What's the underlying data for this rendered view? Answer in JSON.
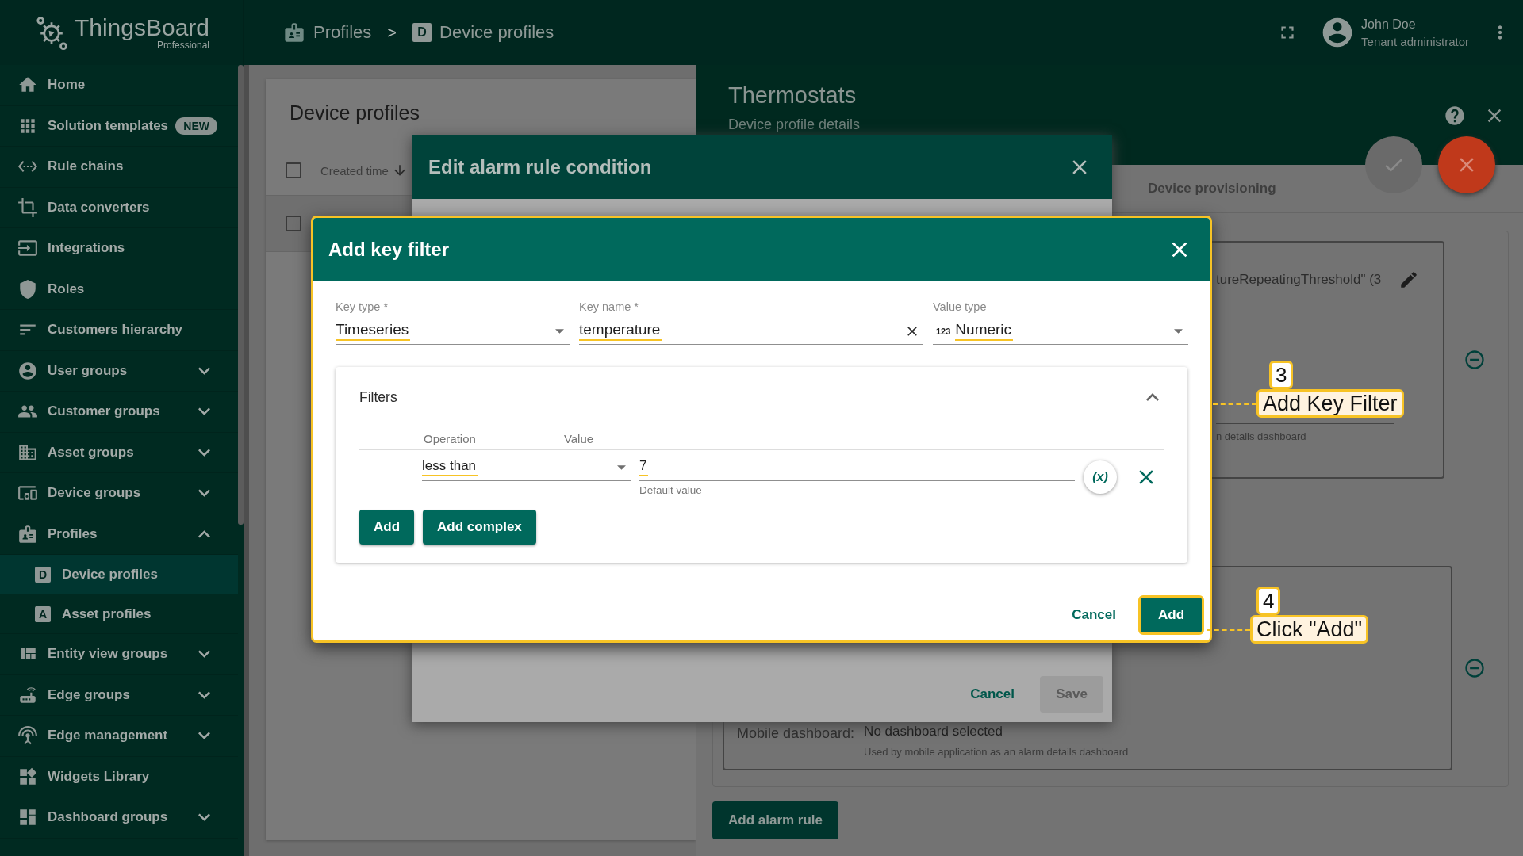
{
  "top_bar": {
    "logo": {
      "name": "ThingsBoard",
      "edition": "Professional"
    },
    "breadcrumbs": [
      {
        "label": "Profiles"
      },
      {
        "label": "Device profiles",
        "icon_text": "D"
      }
    ],
    "breadcrumb_separator": ">",
    "user": {
      "name": "John Doe",
      "role": "Tenant administrator"
    }
  },
  "sidebar": {
    "items": [
      {
        "label": "Home",
        "kind": "link",
        "selected": false
      },
      {
        "label": "Solution templates",
        "kind": "link",
        "badge": "NEW",
        "selected": false
      },
      {
        "label": "Rule chains",
        "kind": "link",
        "selected": false
      },
      {
        "label": "Data converters",
        "kind": "link",
        "selected": false
      },
      {
        "label": "Integrations",
        "kind": "link",
        "selected": false
      },
      {
        "label": "Roles",
        "kind": "link",
        "selected": false
      },
      {
        "label": "Customers hierarchy",
        "kind": "link",
        "selected": false
      },
      {
        "label": "User groups",
        "kind": "group",
        "expanded": false,
        "selected": false
      },
      {
        "label": "Customer groups",
        "kind": "group",
        "expanded": false,
        "selected": false
      },
      {
        "label": "Asset groups",
        "kind": "group",
        "expanded": false,
        "selected": false
      },
      {
        "label": "Device groups",
        "kind": "group",
        "expanded": false,
        "selected": false
      },
      {
        "label": "Profiles",
        "kind": "group",
        "expanded": true,
        "selected": false,
        "children": [
          {
            "label": "Device profiles",
            "icon_text": "D",
            "selected": true
          },
          {
            "label": "Asset profiles",
            "icon_text": "A",
            "selected": false
          }
        ]
      },
      {
        "label": "Entity view groups",
        "kind": "group",
        "expanded": false,
        "selected": false
      },
      {
        "label": "Edge groups",
        "kind": "group",
        "expanded": false,
        "selected": false
      },
      {
        "label": "Edge management",
        "kind": "group",
        "expanded": false,
        "selected": false
      },
      {
        "label": "Widgets Library",
        "kind": "link",
        "selected": false
      },
      {
        "label": "Dashboard groups",
        "kind": "group",
        "expanded": false,
        "selected": false
      }
    ]
  },
  "profiles_list": {
    "title": "Device profiles",
    "header_checked": false,
    "columns": [
      {
        "label": "Created time",
        "sort_descending": true
      }
    ],
    "rows": [
      {
        "checked": false
      }
    ]
  },
  "details_panel": {
    "title": "Thermostats",
    "subtitle": "Device profile details",
    "tabs": [
      {
        "label": "Device provisioning",
        "selected": false
      }
    ],
    "save_disabled": true,
    "alarm_condition": "tureRepeatingThreshold\" (3",
    "dashboard_hint": "n details dashboard",
    "mobile_dashboard": {
      "label": "Mobile dashboard:",
      "value": "No dashboard selected",
      "hint": "Used by mobile application as an alarm details dashboard"
    },
    "add_rule_button": "Add alarm rule"
  },
  "condition_dialog": {
    "title": "Edit alarm rule condition",
    "cancel": "Cancel",
    "save": "Save",
    "save_disabled": true
  },
  "key_filter_dialog": {
    "title": "Add key filter",
    "fields": [
      {
        "label": "Key type *",
        "value": "Timeseries",
        "kind": "select"
      },
      {
        "label": "Key name *",
        "value": "temperature",
        "kind": "clearable"
      },
      {
        "label": "Value type",
        "value": "Numeric",
        "icon_text": "123",
        "kind": "select"
      }
    ],
    "filters": {
      "title": "Filters",
      "expanded": true,
      "columns": [
        "Operation",
        "Value"
      ],
      "rows": [
        {
          "operation": "less than",
          "value": "7",
          "hint": "Default value",
          "dynamic_button": "(x)"
        }
      ],
      "buttons": [
        "Add",
        "Add complex"
      ]
    },
    "cancel": "Cancel",
    "submit": "Add"
  },
  "annotations": [
    {
      "number": "3",
      "label": "Add Key Filter"
    },
    {
      "number": "4",
      "label": "Click \"Add\""
    }
  ]
}
